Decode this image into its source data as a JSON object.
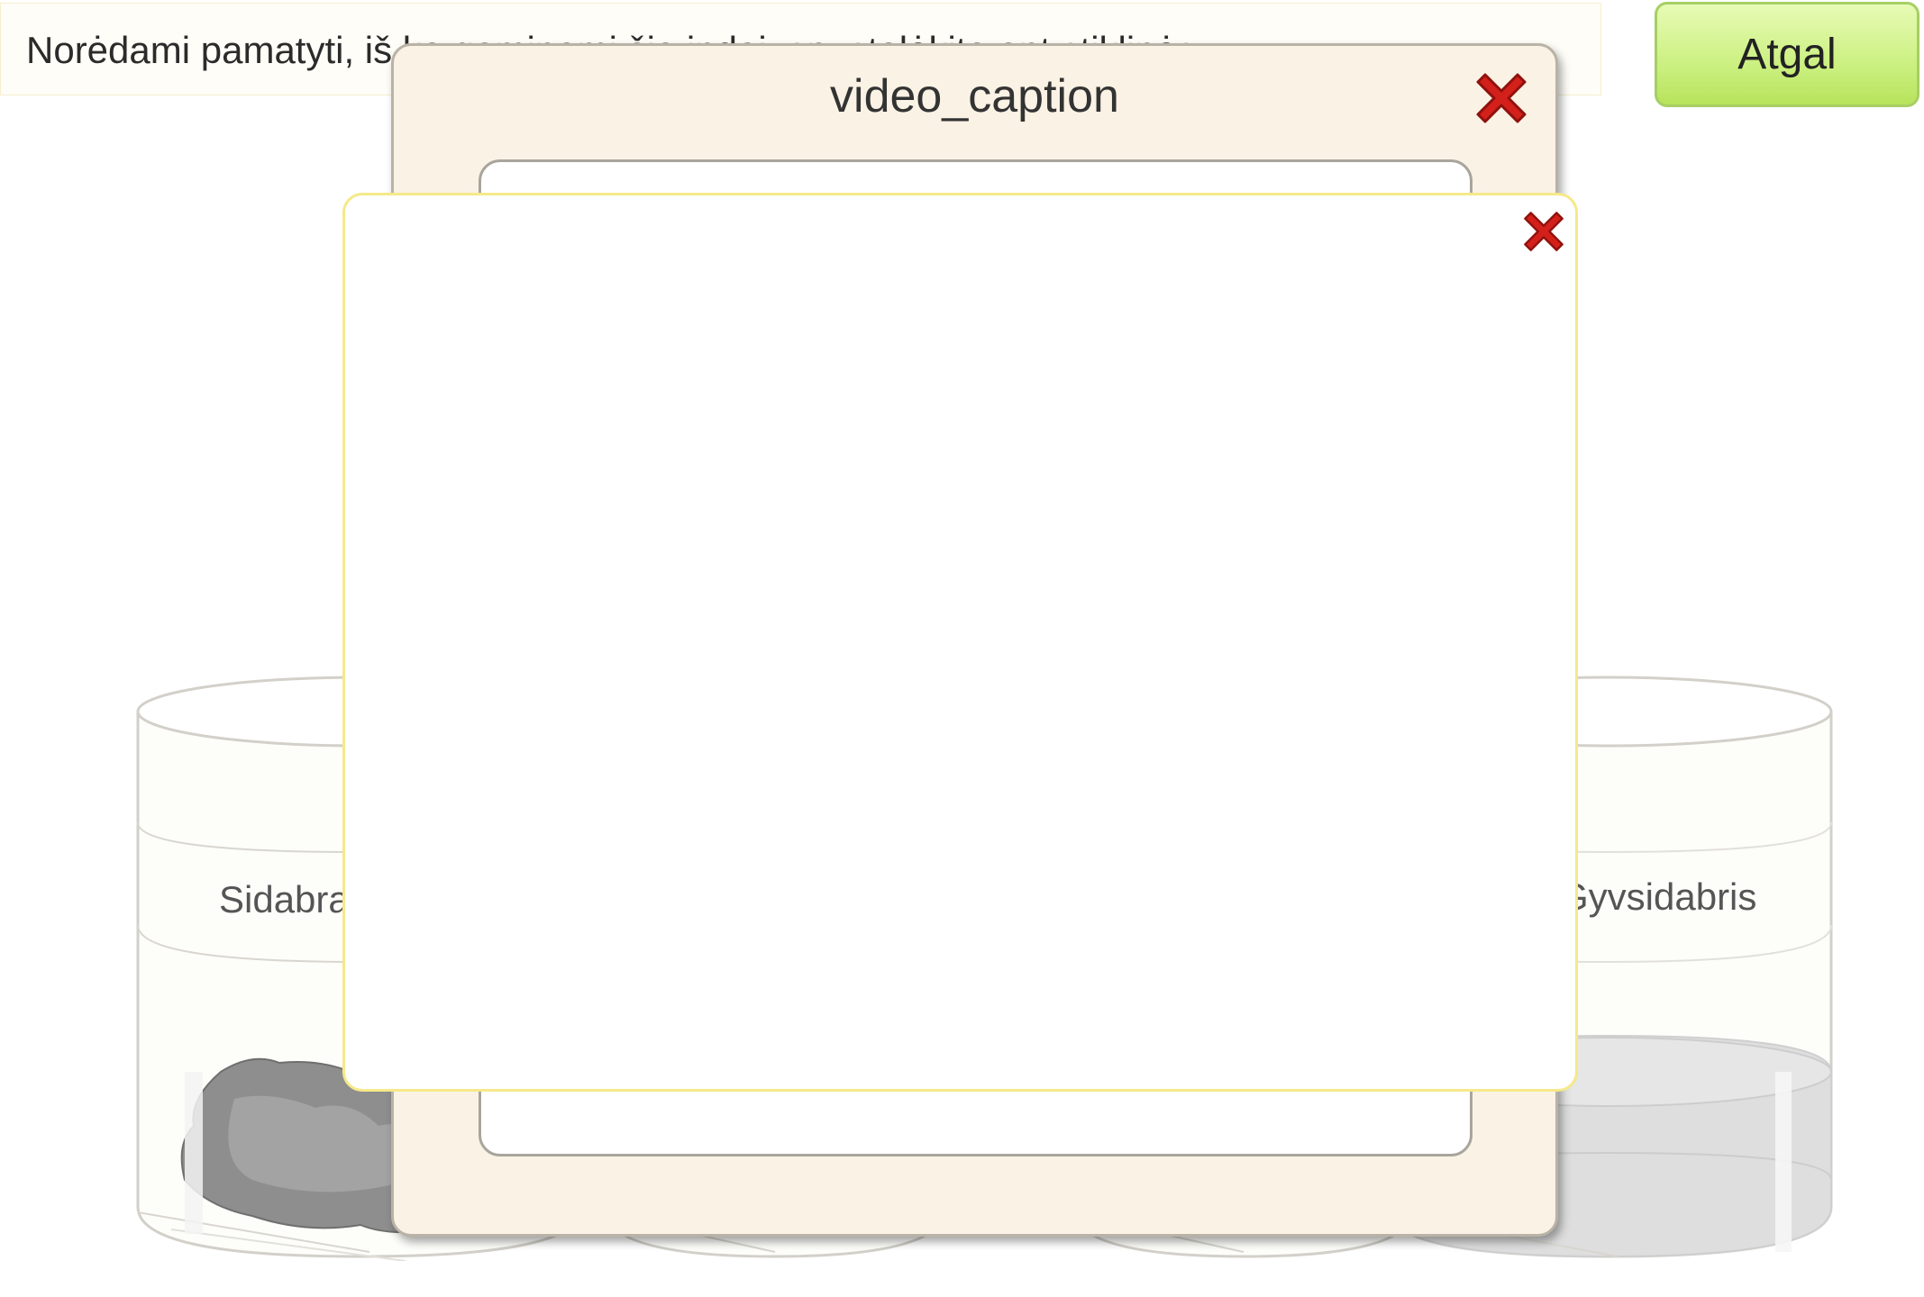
{
  "instruction": {
    "text": "Norėdami pamatyti, iš ko gaminami šie indai, spustelėkite ant stiklinės"
  },
  "back_button": {
    "label": "Atgal"
  },
  "jars": [
    {
      "label": "Sidabras",
      "content": "silver-ore"
    },
    {
      "label": "",
      "content": "empty"
    },
    {
      "label": "",
      "content": "empty"
    },
    {
      "label": "Gyvsidabris",
      "content": "mercury"
    }
  ],
  "video_dialog": {
    "title": "video_caption",
    "close_icon": "close-icon"
  },
  "inner_popup": {
    "close_icon": "close-icon"
  },
  "colors": {
    "button_green": "#c9ef7d",
    "dialog_bg": "#faf2e4",
    "popup_border": "#f5e98a",
    "close_red": "#d3201a"
  }
}
